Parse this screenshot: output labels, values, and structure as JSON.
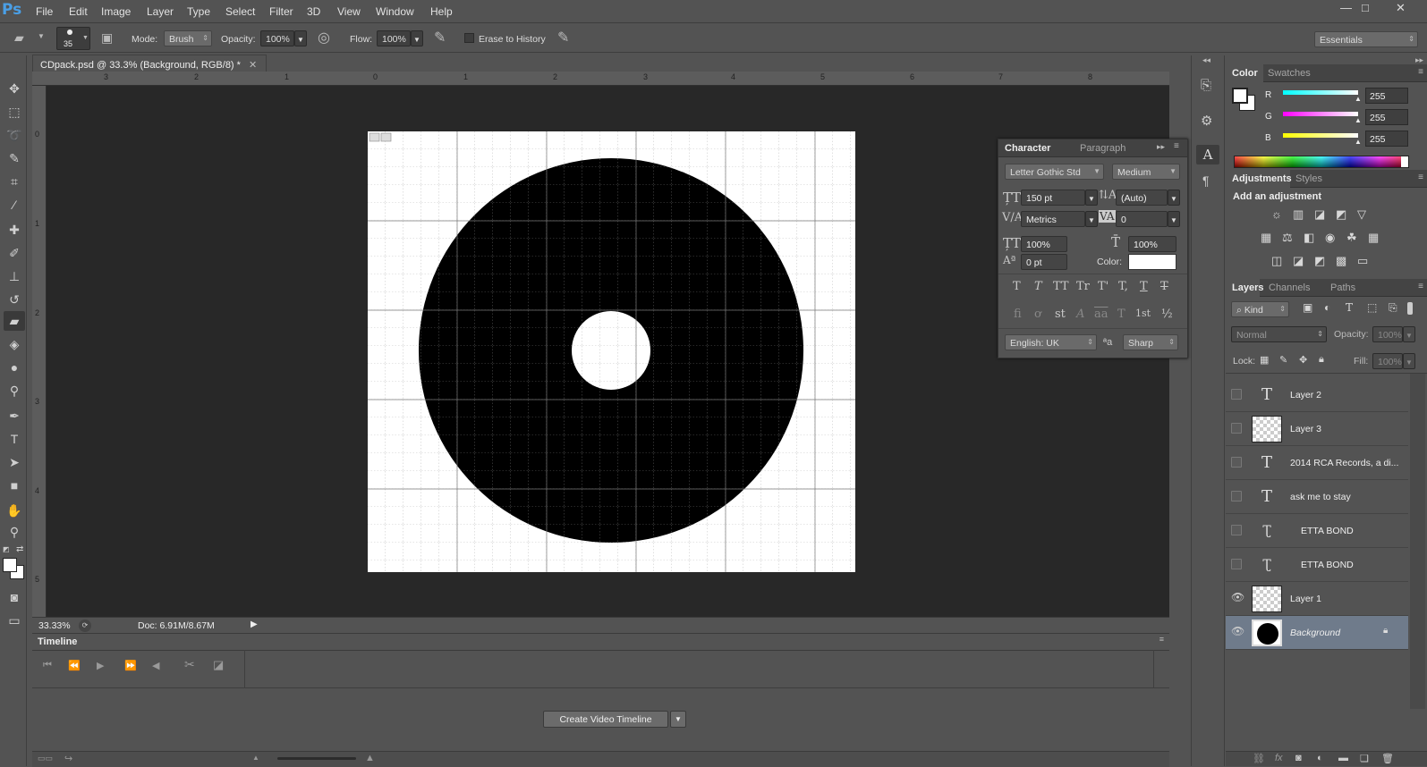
{
  "app": {
    "logo": "Ps"
  },
  "menu": [
    "File",
    "Edit",
    "Image",
    "Layer",
    "Type",
    "Select",
    "Filter",
    "3D",
    "View",
    "Window",
    "Help"
  ],
  "window_controls": [
    "—",
    "□",
    "✕"
  ],
  "options": {
    "brush_size": "35",
    "mode_label": "Mode:",
    "mode_value": "Brush",
    "opacity_label": "Opacity:",
    "opacity_value": "100%",
    "flow_label": "Flow:",
    "flow_value": "100%",
    "erase_history_label": "Erase to History",
    "workspace": "Essentials"
  },
  "document": {
    "tab_title": "CDpack.psd @ 33.3% (Background, RGB/8) *",
    "ruler_h": [
      "3",
      "2",
      "1",
      "0",
      "1",
      "2",
      "3",
      "4",
      "5",
      "6",
      "7",
      "8"
    ],
    "ruler_v": [
      "0",
      "1",
      "2",
      "3",
      "4",
      "5"
    ],
    "zoom": "33.33%",
    "doc_size": "Doc: 6.91M/8.67M"
  },
  "timeline": {
    "title": "Timeline",
    "create_button": "Create Video Timeline"
  },
  "character": {
    "tab_active": "Character",
    "tab_other": "Paragraph",
    "font_family": "Letter Gothic Std",
    "font_style": "Medium",
    "size": "150 pt",
    "leading": "(Auto)",
    "kerning": "Metrics",
    "tracking": "0",
    "vscale": "100%",
    "hscale": "100%",
    "baseline": "0 pt",
    "color_label": "Color:",
    "style_buttons": [
      "T",
      "T",
      "TT",
      "Tr",
      "T'",
      "T,",
      "T",
      "T"
    ],
    "opentype_buttons": [
      "fi",
      "ơ",
      "st",
      "A",
      "aa",
      "T",
      "1st",
      "½"
    ],
    "language": "English: UK",
    "aa_label": "ªa",
    "antialias": "Sharp"
  },
  "color_panel": {
    "tab_active": "Color",
    "tab_other": "Swatches",
    "r_label": "R",
    "g_label": "G",
    "b_label": "B",
    "r": "255",
    "g": "255",
    "b": "255"
  },
  "adjustments": {
    "tab_active": "Adjustments",
    "tab_other": "Styles",
    "heading": "Add an adjustment"
  },
  "layers_panel": {
    "tab_active": "Layers",
    "tabs_other": [
      "Channels",
      "Paths"
    ],
    "kind_label": "Kind",
    "blend_mode": "Normal",
    "opacity_label": "Opacity:",
    "opacity_value": "100%",
    "lock_label": "Lock:",
    "fill_label": "Fill:",
    "fill_value": "100%",
    "layers": [
      {
        "name": "Layer 2",
        "type": "text",
        "visible": false
      },
      {
        "name": "Layer 3",
        "type": "raster",
        "visible": false
      },
      {
        "name": "2014 RCA Records, a di...",
        "type": "text",
        "visible": false
      },
      {
        "name": "ask me to stay",
        "type": "text",
        "visible": false
      },
      {
        "name": "ETTA BOND",
        "type": "warped-text",
        "visible": false
      },
      {
        "name": "ETTA BOND",
        "type": "warped-text",
        "visible": false
      },
      {
        "name": "Layer 1",
        "type": "raster",
        "visible": true
      },
      {
        "name": "Background",
        "type": "background",
        "visible": true,
        "selected": true
      }
    ]
  }
}
